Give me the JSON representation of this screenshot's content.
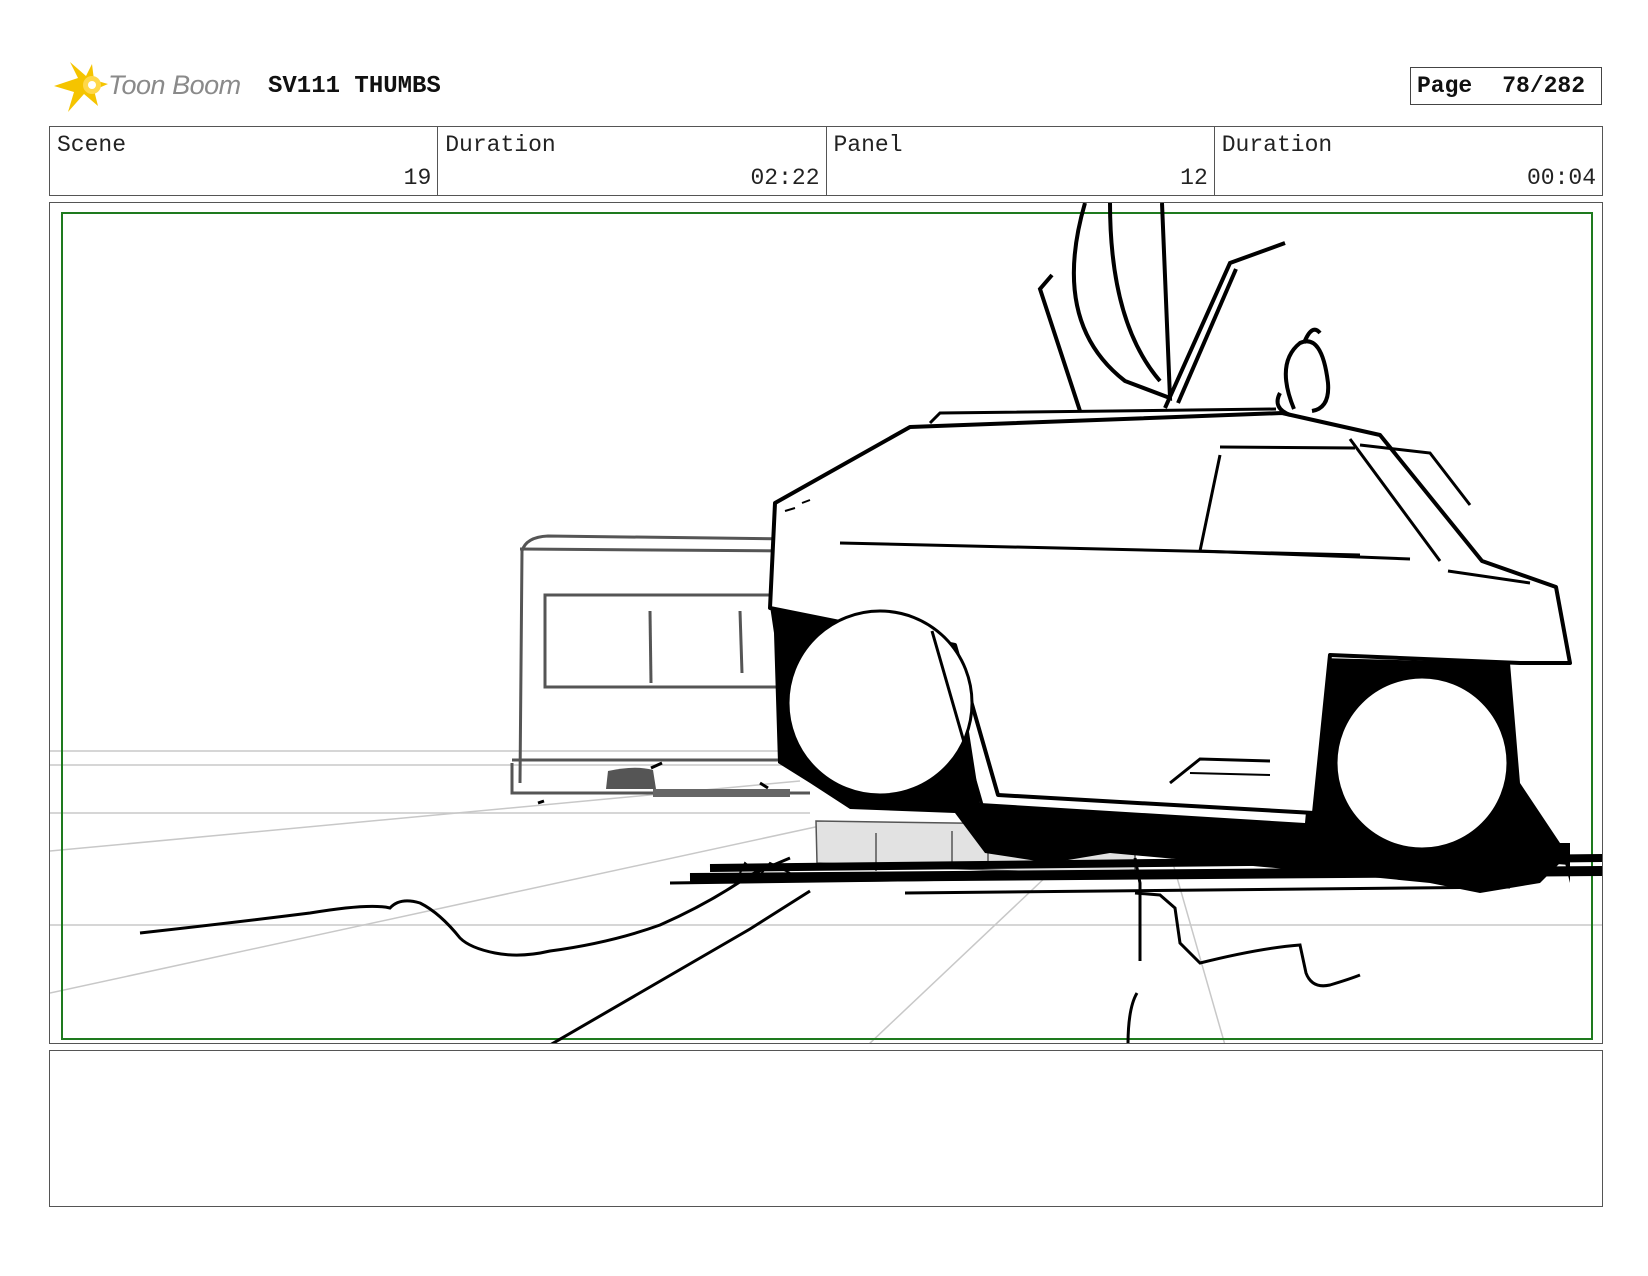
{
  "header": {
    "brand": "Toon Boom",
    "document_title": "SV111 THUMBS",
    "page_label": "Page",
    "page_number": "78/282"
  },
  "info": {
    "scene_label": "Scene",
    "scene_value": "19",
    "scene_duration_label": "Duration",
    "scene_duration_value": "02:22",
    "panel_label": "Panel",
    "panel_value": "12",
    "panel_duration_label": "Duration",
    "panel_duration_value": "00:04"
  },
  "colors": {
    "logo_accent": "#f5c400",
    "safe_frame": "#1e7a1e",
    "ink": "#000000",
    "guide_lines": "#c8c8c8",
    "shadow_fill": "#e2e2e2"
  },
  "icons": {
    "logo": "toon-boom-comet-icon"
  }
}
